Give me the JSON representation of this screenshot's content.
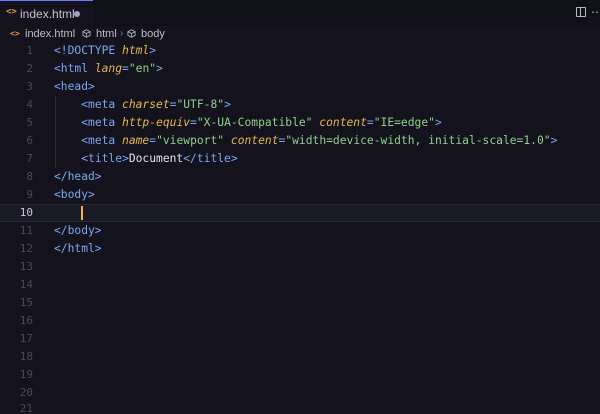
{
  "tab": {
    "icon": "<>",
    "filename": "index.html"
  },
  "toolbar": {
    "split_icon": "split-editor-icon",
    "more_icon": "more-actions-icon"
  },
  "breadcrumb": {
    "file": "index.html",
    "html": "html",
    "body": "body"
  },
  "colors": {
    "accent": "#6e7bff",
    "tag": "#7aa6f0",
    "attr": "#e5b849",
    "string": "#8ed08b",
    "cursor": "#f2b33d"
  },
  "editor": {
    "line_numbers": [
      "1",
      "2",
      "3",
      "4",
      "5",
      "6",
      "7",
      "8",
      "9",
      "10",
      "11",
      "12",
      "13",
      "14",
      "15",
      "16",
      "17",
      "18",
      "19",
      "20",
      "21"
    ],
    "active_line": "10"
  }
}
